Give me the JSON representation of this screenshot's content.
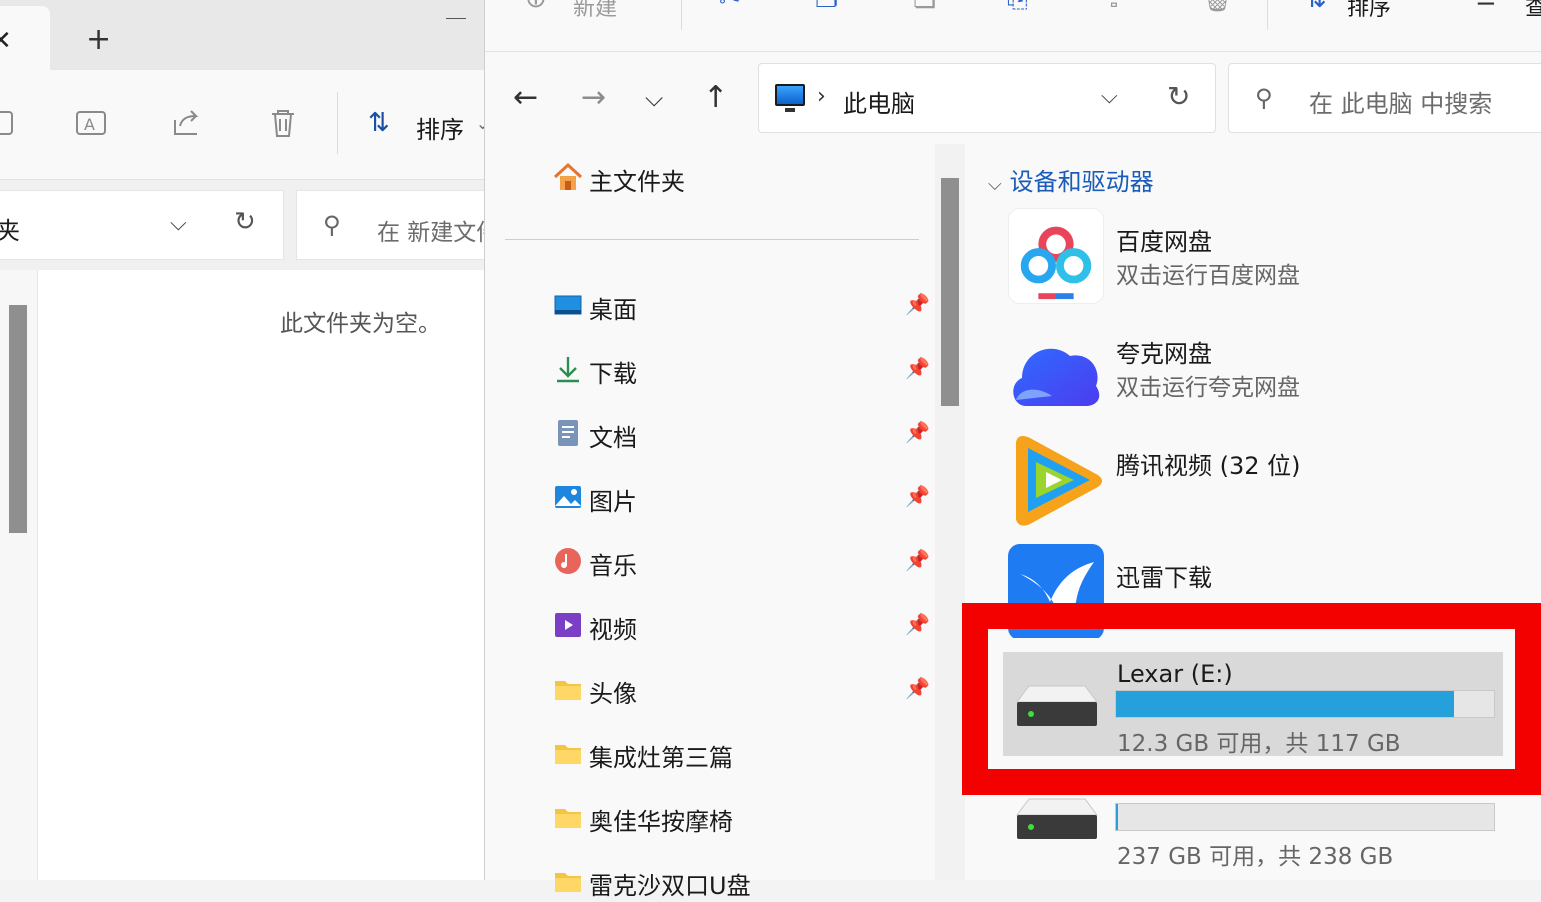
{
  "colors": {
    "accent": "#1b5cb8",
    "highlight": "#f30000",
    "progress": "#26a0da",
    "selection": "#d9d9d9"
  },
  "back_window": {
    "tab_close_icon": "close-icon",
    "new_tab_label": "+",
    "sort_label": "排序",
    "address_text": "夹",
    "search_placeholder": "在 新建文件夹 中搜索",
    "empty_message": "此文件夹为空。"
  },
  "front_window": {
    "ribbon": {
      "new_label": "新建",
      "sort_label": "排序",
      "view_label": "查"
    },
    "address": {
      "location": "此电脑"
    },
    "search": {
      "placeholder": "在 此电脑 中搜索"
    },
    "nav": {
      "home": "主文件夹",
      "items": [
        {
          "label": "桌面",
          "icon": "desktop-icon",
          "pinned": true
        },
        {
          "label": "下载",
          "icon": "download-icon",
          "pinned": true
        },
        {
          "label": "文档",
          "icon": "document-icon",
          "pinned": true
        },
        {
          "label": "图片",
          "icon": "pictures-icon",
          "pinned": true
        },
        {
          "label": "音乐",
          "icon": "music-icon",
          "pinned": true
        },
        {
          "label": "视频",
          "icon": "video-icon",
          "pinned": true
        },
        {
          "label": "头像",
          "icon": "folder-icon",
          "pinned": true
        },
        {
          "label": "集成灶第三篇",
          "icon": "folder-icon",
          "pinned": false
        },
        {
          "label": "奥佳华按摩椅",
          "icon": "folder-icon",
          "pinned": false
        },
        {
          "label": "雷克沙双口U盘",
          "icon": "folder-icon",
          "pinned": false
        }
      ]
    },
    "main": {
      "group_title": "设备和驱动器",
      "apps": [
        {
          "name": "百度网盘",
          "subtitle": "双击运行百度网盘",
          "icon": "baidu-netdisk-icon"
        },
        {
          "name": "夸克网盘",
          "subtitle": "双击运行夸克网盘",
          "icon": "quark-netdisk-icon"
        },
        {
          "name": "腾讯视频 (32 位)",
          "subtitle": "",
          "icon": "tencent-video-icon"
        },
        {
          "name": "迅雷下载",
          "subtitle": "",
          "icon": "thunder-icon"
        }
      ],
      "drives": [
        {
          "name": "Lexar (E:)",
          "info": "12.3 GB 可用，共 117 GB",
          "used_fraction": 0.895,
          "selected": true
        },
        {
          "name": "",
          "info": "237 GB 可用，共 238 GB",
          "used_fraction": 0.004,
          "selected": false
        }
      ]
    }
  }
}
